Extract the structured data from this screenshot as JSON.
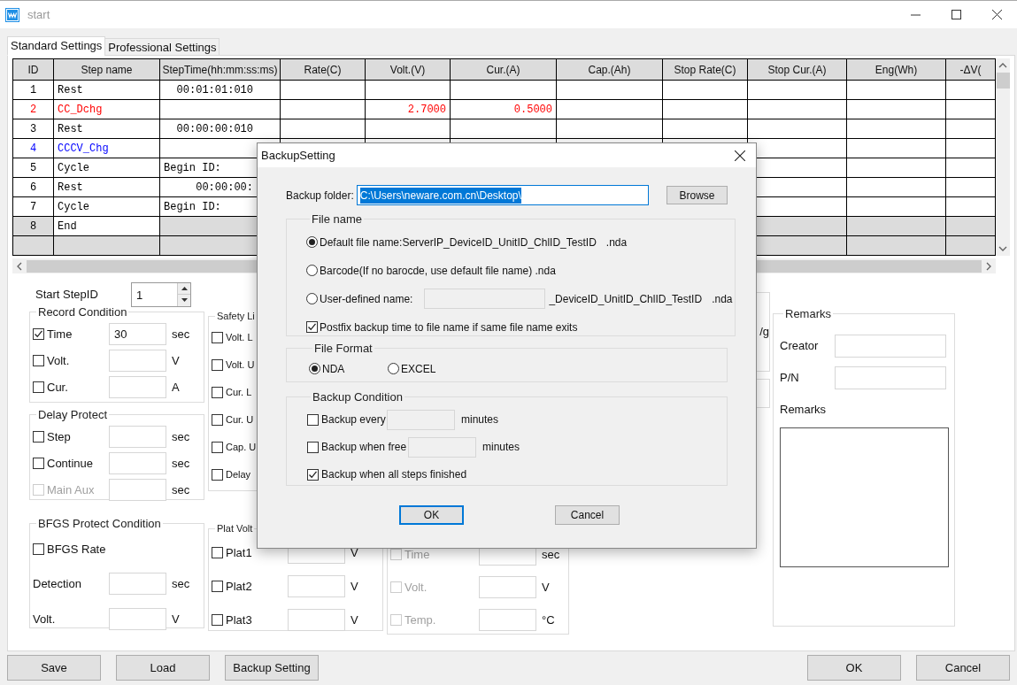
{
  "window": {
    "title": "start"
  },
  "tabs": [
    {
      "label": "Standard Settings",
      "selected": true
    },
    {
      "label": "Professional Settings",
      "selected": false
    }
  ],
  "table": {
    "columns": [
      "ID",
      "Step name",
      "StepTime(hh:mm:ss:ms)",
      "Rate(C)",
      "Volt.(V)",
      "Cur.(A)",
      "Cap.(Ah)",
      "Stop Rate(C)",
      "Stop Cur.(A)",
      "Eng(Wh)",
      "-ΔV("
    ],
    "rows": [
      {
        "kind": "step",
        "id": "1",
        "name": "Rest",
        "time": "00:01:01:010",
        "color": "#000000"
      },
      {
        "kind": "step",
        "id": "2",
        "name": "CC_Dchg",
        "volt": "2.7000",
        "cur": "0.5000",
        "color": "#ff0000"
      },
      {
        "kind": "step",
        "id": "3",
        "name": "Rest",
        "time": "00:00:00:010",
        "color": "#000000"
      },
      {
        "kind": "step",
        "id": "4",
        "name": "CCCV_Chg",
        "color": "#0000ff"
      },
      {
        "kind": "cycle",
        "id": "5",
        "name": "Cycle",
        "begin": "Begin ID:",
        "color": "#000000"
      },
      {
        "kind": "step",
        "id": "6",
        "name": "Rest",
        "time": "00:00:00:",
        "color": "#000000"
      },
      {
        "kind": "cycle",
        "id": "7",
        "name": "Cycle",
        "begin": "Begin ID:",
        "color": "#000000"
      },
      {
        "kind": "end",
        "id": "8",
        "name": "End",
        "color": "#000000"
      },
      {
        "kind": "blank"
      }
    ]
  },
  "start_step": {
    "label": "Start StepID",
    "value": "1"
  },
  "record_condition": {
    "title": "Record Condition",
    "items": [
      {
        "label": "Time",
        "checked": true,
        "value": "30",
        "unit": "sec"
      },
      {
        "label": "Volt.",
        "checked": false,
        "unit": "V"
      },
      {
        "label": "Cur.",
        "checked": false,
        "unit": "A"
      }
    ]
  },
  "delay_protect": {
    "title": "Delay Protect",
    "items": [
      {
        "label": "Step",
        "checked": false,
        "disabled": false,
        "unit": "sec"
      },
      {
        "label": "Continue",
        "checked": false,
        "disabled": false,
        "unit": "sec"
      },
      {
        "label": "Main Aux",
        "checked": false,
        "disabled": true,
        "unit": "sec"
      }
    ]
  },
  "safety_limits": {
    "title": "Safety Li",
    "items": [
      {
        "label": "Volt. L",
        "checked": false
      },
      {
        "label": "Volt. U",
        "checked": false
      },
      {
        "label": "Cur. L",
        "checked": false
      },
      {
        "label": "Cur. U",
        "checked": false
      },
      {
        "label": "Cap. U",
        "checked": false
      },
      {
        "label": "Delay",
        "checked": false
      }
    ]
  },
  "bfgs": {
    "title": "BFGS Protect Condition",
    "items": [
      {
        "kind": "checkbox",
        "label": "BFGS Rate",
        "checked": false
      },
      {
        "kind": "field",
        "label": "Detection",
        "unit": "sec"
      },
      {
        "kind": "field",
        "label": "Volt.",
        "unit": "V"
      }
    ]
  },
  "plat_volt": {
    "title": "Plat Volt",
    "items": [
      {
        "label": "Plat1",
        "checked": false,
        "unit": "V"
      },
      {
        "label": "Plat2",
        "checked": false,
        "unit": "V"
      },
      {
        "label": "Plat3",
        "checked": false,
        "unit": "V"
      }
    ]
  },
  "aux_group": {
    "items": [
      {
        "label": "Time",
        "checked": false,
        "disabled": true,
        "unit": "sec"
      },
      {
        "label": "Volt.",
        "checked": false,
        "disabled": true,
        "unit": "V"
      },
      {
        "label": "Temp.",
        "checked": false,
        "disabled": true,
        "unit": "°C"
      }
    ]
  },
  "hidden_group": {
    "unit": "/g"
  },
  "remarks": {
    "title": "Remarks",
    "creator_label": "Creator",
    "pn_label": "P/N",
    "remarks_label": "Remarks"
  },
  "buttons_left": [
    "Save",
    "Load",
    "Backup Setting"
  ],
  "buttons_right": [
    "OK",
    "Cancel"
  ],
  "dialog": {
    "title": "BackupSetting",
    "folder_label": "Backup folder:",
    "folder_value": "C:\\Users\\neware.com.cn\\Desktop\\",
    "browse": "Browse",
    "file_name": {
      "title": "File name",
      "options": [
        {
          "kind": "plain",
          "label": "Default file name:ServerIP_DeviceID_UnitID_ChlID_TestID",
          "suffix": ".nda",
          "selected": true
        },
        {
          "kind": "plain",
          "label": "Barcode(If no barocde, use default file name) .nda",
          "selected": false
        },
        {
          "kind": "custom",
          "label": "User-defined name:",
          "middle": "_DeviceID_UnitID_ChlID_TestID",
          "suffix": ".nda",
          "selected": false
        }
      ],
      "postfix": {
        "label": "Postfix backup time to file name if same file name exits",
        "checked": true
      }
    },
    "file_format": {
      "title": "File Format",
      "options": [
        {
          "label": "NDA",
          "selected": true
        },
        {
          "label": "EXCEL",
          "selected": false
        }
      ]
    },
    "backup_condition": {
      "title": "Backup Condition",
      "items": [
        {
          "label": "Backup every",
          "checked": false,
          "unit": "minutes"
        },
        {
          "label": "Backup when free",
          "checked": false,
          "unit": "minutes"
        },
        {
          "label": "Backup when all steps finished",
          "checked": true
        }
      ]
    },
    "buttons": [
      "OK",
      "Cancel"
    ]
  }
}
